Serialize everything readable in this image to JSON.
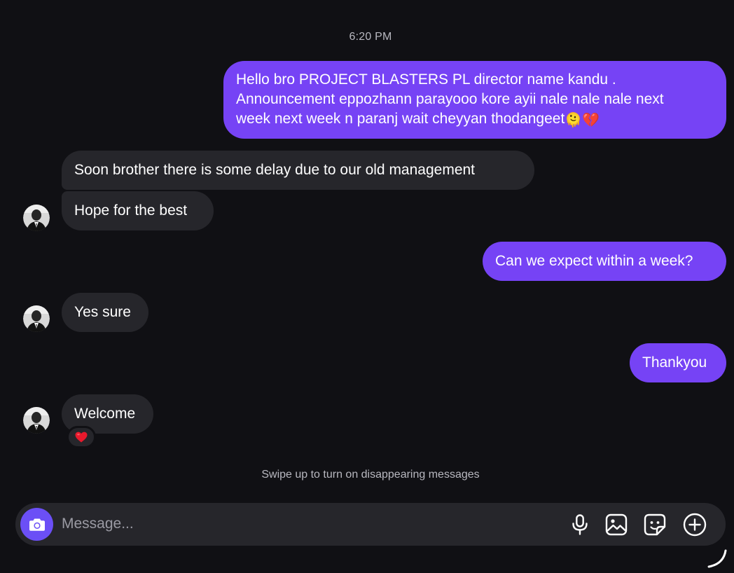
{
  "timestamp": "6:20 PM",
  "messages": [
    {
      "from": "me",
      "lines": [
        "Hello bro PROJECT BLASTERS PL director name kandu .",
        "Announcement eppozhann parayooo kore ayii nale nale nale next",
        "week next week n paranj wait cheyyan thodangeet"
      ],
      "trailing_emoji": [
        "melting-face",
        "broken-heart"
      ]
    },
    {
      "from": "them",
      "text": "Soon brother there is some delay due to our old management"
    },
    {
      "from": "them",
      "text": "Hope for the best"
    },
    {
      "from": "me",
      "text": "Can we expect within a week?"
    },
    {
      "from": "them",
      "text": "Yes sure"
    },
    {
      "from": "me",
      "text": "Thankyou"
    },
    {
      "from": "them",
      "text": "Welcome",
      "reaction": "red-heart"
    }
  ],
  "hint": "Swipe up to turn on disappearing messages",
  "composer": {
    "placeholder": "Message...",
    "icons": [
      "camera-icon",
      "microphone-icon",
      "image-icon",
      "sticker-icon",
      "plus-circle-icon"
    ]
  },
  "colors": {
    "background": "#101014",
    "sent_bubble": "#7643f5",
    "received_bubble": "#26262b",
    "accent": "#6b4ff6"
  }
}
